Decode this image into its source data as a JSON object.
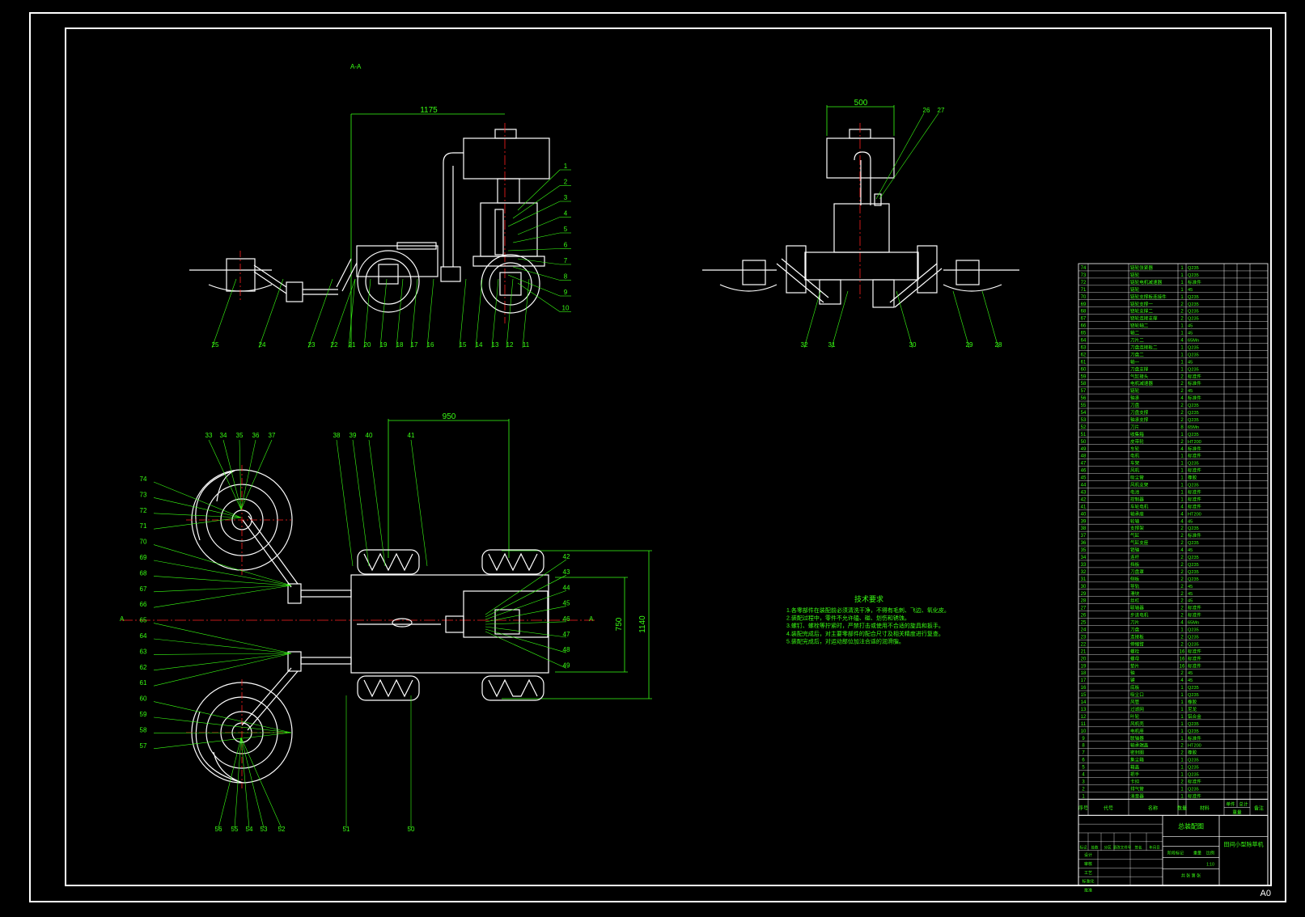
{
  "sheet": {
    "section_label": "A-A",
    "sheet_size": "A0",
    "colors": {
      "background": "#000000",
      "frame": "#ffffff",
      "geometry": "#ffffff",
      "dimension": "#39ff14",
      "centerline": "#ff2020",
      "text": "#39ff14"
    }
  },
  "views": {
    "front": {
      "dim_width": "1175",
      "callouts_right": [
        "1",
        "2",
        "3",
        "4",
        "5",
        "6",
        "7",
        "8",
        "9",
        "10"
      ],
      "callouts_bottom": [
        "25",
        "24",
        "23",
        "22",
        "21",
        "20",
        "19",
        "18",
        "17",
        "16",
        "15",
        "14",
        "13",
        "12",
        "11"
      ]
    },
    "side": {
      "dim_width": "500",
      "callouts_top": [
        "26",
        "27"
      ],
      "callouts_bottom": [
        "32",
        "31",
        "30",
        "29",
        "28"
      ]
    },
    "plan": {
      "dim_wheelbase": "950",
      "dim_body_width": "750",
      "dim_track_width": "1140",
      "section_left": "A",
      "section_right": "A",
      "callouts_top": [
        "33",
        "34",
        "35",
        "36",
        "37",
        "38",
        "39",
        "40",
        "41"
      ],
      "callouts_left": [
        "74",
        "73",
        "72",
        "71",
        "70",
        "69",
        "68",
        "67",
        "66",
        "65",
        "64",
        "63",
        "62",
        "61",
        "60",
        "59",
        "58",
        "57"
      ],
      "callouts_right": [
        "42",
        "43",
        "44",
        "45",
        "46",
        "47",
        "48",
        "49"
      ],
      "callouts_bottom": [
        "56",
        "55",
        "54",
        "53",
        "52",
        "51",
        "50"
      ]
    }
  },
  "notes": {
    "title": "技术要求",
    "lines": [
      "1.各零部件在装配前必须清洗干净，不得有毛刺、飞边、氧化皮。",
      "2.装配过程中，零件不允许磕、碰、划伤和锈蚀。",
      "3.螺钉、螺栓等拧紧时，严禁打击或使用不合适的旋具和扳手。",
      "4.装配完成后，对主要零部件的配合尺寸及相关精度进行复查。",
      "5.装配完成后，对运动部位加注合适的润滑脂。"
    ]
  },
  "bom": {
    "rows": [
      {
        "no": "74",
        "name": "链轮张紧器",
        "qty": "1",
        "mat": "Q235"
      },
      {
        "no": "73",
        "name": "链轮",
        "qty": "1",
        "mat": "Q235"
      },
      {
        "no": "72",
        "name": "链轮电机减速器",
        "qty": "1",
        "mat": "标准件"
      },
      {
        "no": "71",
        "name": "链轮",
        "qty": "1",
        "mat": "45"
      },
      {
        "no": "70",
        "name": "链轮支撑板连接件",
        "qty": "1",
        "mat": "Q235"
      },
      {
        "no": "69",
        "name": "链轮支撑一",
        "qty": "2",
        "mat": "Q235"
      },
      {
        "no": "68",
        "name": "链轮支撑二",
        "qty": "2",
        "mat": "Q235"
      },
      {
        "no": "67",
        "name": "链轮连接支撑",
        "qty": "2",
        "mat": "Q235"
      },
      {
        "no": "66",
        "name": "链轮轴二",
        "qty": "1",
        "mat": "45"
      },
      {
        "no": "65",
        "name": "轴二",
        "qty": "1",
        "mat": "45"
      },
      {
        "no": "64",
        "name": "刀片二",
        "qty": "4",
        "mat": "65Mn"
      },
      {
        "no": "63",
        "name": "刀盘连接板二",
        "qty": "1",
        "mat": "Q235"
      },
      {
        "no": "62",
        "name": "刀盘二",
        "qty": "1",
        "mat": "Q235"
      },
      {
        "no": "61",
        "name": "轴一",
        "qty": "1",
        "mat": "45"
      },
      {
        "no": "60",
        "name": "刀盘支撑",
        "qty": "1",
        "mat": "Q235"
      },
      {
        "no": "59",
        "name": "气缸接头",
        "qty": "2",
        "mat": "标准件"
      },
      {
        "no": "58",
        "name": "电机减速器",
        "qty": "2",
        "mat": "标准件"
      },
      {
        "no": "57",
        "name": "链轮",
        "qty": "2",
        "mat": "45"
      },
      {
        "no": "56",
        "name": "轴承",
        "qty": "4",
        "mat": "标准件"
      },
      {
        "no": "55",
        "name": "刀盘",
        "qty": "2",
        "mat": "Q235"
      },
      {
        "no": "54",
        "name": "刀盘支撑",
        "qty": "2",
        "mat": "Q235"
      },
      {
        "no": "53",
        "name": "轴承支撑",
        "qty": "2",
        "mat": "Q235"
      },
      {
        "no": "52",
        "name": "刀片",
        "qty": "8",
        "mat": "65Mn"
      },
      {
        "no": "51",
        "name": "收集箱",
        "qty": "1",
        "mat": "Q235"
      },
      {
        "no": "50",
        "name": "皮带轮",
        "qty": "2",
        "mat": "HT200"
      },
      {
        "no": "49",
        "name": "车轮",
        "qty": "4",
        "mat": "标准件"
      },
      {
        "no": "48",
        "name": "电机",
        "qty": "1",
        "mat": "标准件"
      },
      {
        "no": "47",
        "name": "车架",
        "qty": "1",
        "mat": "Q235"
      },
      {
        "no": "46",
        "name": "风机",
        "qty": "1",
        "mat": "标准件"
      },
      {
        "no": "45",
        "name": "吸尘管",
        "qty": "1",
        "mat": "橡胶"
      },
      {
        "no": "44",
        "name": "风机支架",
        "qty": "1",
        "mat": "Q235"
      },
      {
        "no": "43",
        "name": "电池",
        "qty": "1",
        "mat": "标准件"
      },
      {
        "no": "42",
        "name": "控制器",
        "qty": "1",
        "mat": "标准件"
      },
      {
        "no": "41",
        "name": "车轮电机",
        "qty": "4",
        "mat": "标准件"
      },
      {
        "no": "40",
        "name": "轴承座",
        "qty": "4",
        "mat": "HT200"
      },
      {
        "no": "39",
        "name": "轮轴",
        "qty": "4",
        "mat": "45"
      },
      {
        "no": "38",
        "name": "支撑架",
        "qty": "2",
        "mat": "Q235"
      },
      {
        "no": "37",
        "name": "气缸",
        "qty": "2",
        "mat": "标准件"
      },
      {
        "no": "36",
        "name": "气缸支座",
        "qty": "2",
        "mat": "Q235"
      },
      {
        "no": "35",
        "name": "销轴",
        "qty": "4",
        "mat": "45"
      },
      {
        "no": "34",
        "name": "连杆",
        "qty": "2",
        "mat": "Q235"
      },
      {
        "no": "33",
        "name": "挡板",
        "qty": "2",
        "mat": "Q235"
      },
      {
        "no": "32",
        "name": "刀盘罩",
        "qty": "2",
        "mat": "Q235"
      },
      {
        "no": "31",
        "name": "侧板",
        "qty": "2",
        "mat": "Q235"
      },
      {
        "no": "30",
        "name": "导轨",
        "qty": "2",
        "mat": "45"
      },
      {
        "no": "29",
        "name": "滑块",
        "qty": "2",
        "mat": "45"
      },
      {
        "no": "28",
        "name": "丝杠",
        "qty": "2",
        "mat": "45"
      },
      {
        "no": "27",
        "name": "联轴器",
        "qty": "2",
        "mat": "标准件"
      },
      {
        "no": "26",
        "name": "步进电机",
        "qty": "2",
        "mat": "标准件"
      },
      {
        "no": "25",
        "name": "刀片",
        "qty": "4",
        "mat": "65Mn"
      },
      {
        "no": "24",
        "name": "刀盘",
        "qty": "1",
        "mat": "Q235"
      },
      {
        "no": "23",
        "name": "连接板",
        "qty": "2",
        "mat": "Q235"
      },
      {
        "no": "22",
        "name": "伸缩臂",
        "qty": "2",
        "mat": "Q235"
      },
      {
        "no": "21",
        "name": "螺栓",
        "qty": "16",
        "mat": "标准件"
      },
      {
        "no": "20",
        "name": "螺母",
        "qty": "16",
        "mat": "标准件"
      },
      {
        "no": "19",
        "name": "垫片",
        "qty": "16",
        "mat": "标准件"
      },
      {
        "no": "18",
        "name": "轴",
        "qty": "2",
        "mat": "45"
      },
      {
        "no": "17",
        "name": "键",
        "qty": "4",
        "mat": "45"
      },
      {
        "no": "16",
        "name": "底板",
        "qty": "1",
        "mat": "Q235"
      },
      {
        "no": "15",
        "name": "吸尘口",
        "qty": "1",
        "mat": "Q235"
      },
      {
        "no": "14",
        "name": "风管",
        "qty": "1",
        "mat": "橡胶"
      },
      {
        "no": "13",
        "name": "过滤网",
        "qty": "1",
        "mat": "尼龙"
      },
      {
        "no": "12",
        "name": "叶轮",
        "qty": "1",
        "mat": "铝合金"
      },
      {
        "no": "11",
        "name": "风机壳",
        "qty": "1",
        "mat": "Q235"
      },
      {
        "no": "10",
        "name": "电机座",
        "qty": "1",
        "mat": "Q235"
      },
      {
        "no": "9",
        "name": "联轴器",
        "qty": "1",
        "mat": "标准件"
      },
      {
        "no": "8",
        "name": "轴承端盖",
        "qty": "2",
        "mat": "HT200"
      },
      {
        "no": "7",
        "name": "密封圈",
        "qty": "2",
        "mat": "橡胶"
      },
      {
        "no": "6",
        "name": "集尘箱",
        "qty": "1",
        "mat": "Q235"
      },
      {
        "no": "5",
        "name": "箱盖",
        "qty": "1",
        "mat": "Q235"
      },
      {
        "no": "4",
        "name": "把手",
        "qty": "1",
        "mat": "Q235"
      },
      {
        "no": "3",
        "name": "卡扣",
        "qty": "2",
        "mat": "标准件"
      },
      {
        "no": "2",
        "name": "排气管",
        "qty": "1",
        "mat": "Q235"
      },
      {
        "no": "1",
        "name": "消音器",
        "qty": "1",
        "mat": "标准件"
      }
    ],
    "header": {
      "no": "序号",
      "code": "代号",
      "name": "名称",
      "qty": "数量",
      "mat": "材料",
      "weight_single": "单件",
      "weight_total": "总计",
      "weight": "重量",
      "remark": "备注"
    }
  },
  "title_block": {
    "drawing_title": "总装配图",
    "machine_name": "田间小型除草机",
    "row_labels": [
      "标记",
      "处数",
      "分区",
      "更改文件号",
      "签名",
      "年月日"
    ],
    "role_labels": [
      "设计",
      "审核",
      "工艺",
      "标准化",
      "批准"
    ],
    "stage_label": "阶段标记",
    "weight_label": "重量",
    "scale_label": "比例",
    "scale_value": "1:10",
    "sheet_labels": "共 张 第 张"
  }
}
